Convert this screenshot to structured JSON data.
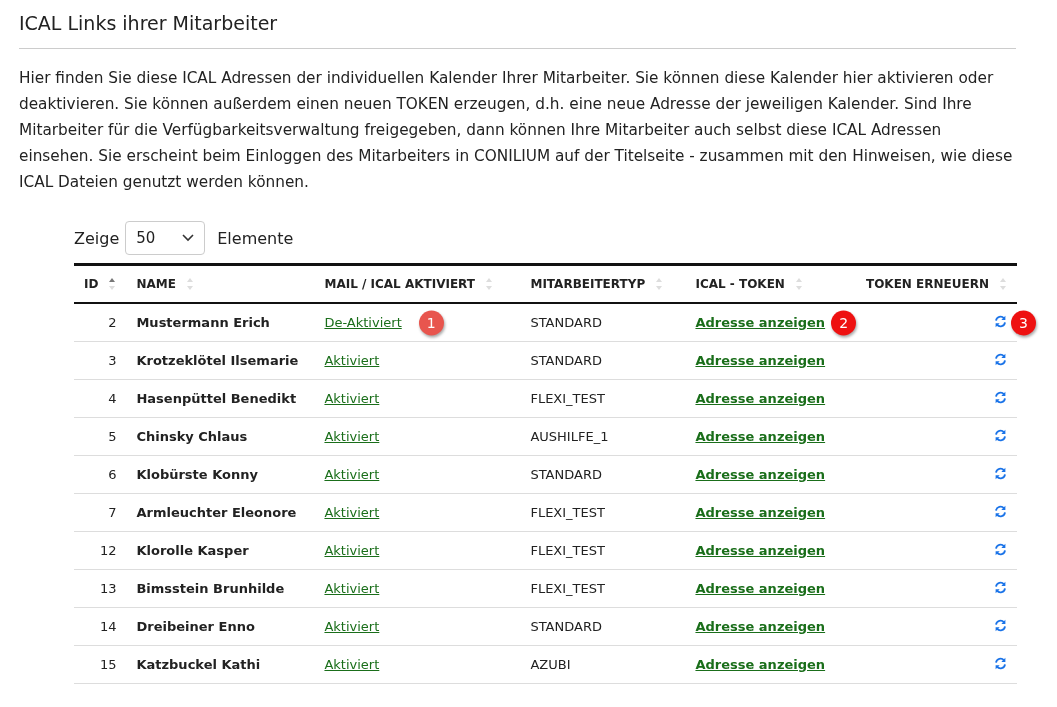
{
  "title": "ICAL Links ihrer Mitarbeiter",
  "intro": "Hier finden Sie diese ICAL Adressen der individuellen Kalender Ihrer Mitarbeiter. Sie können diese Kalender hier aktivieren oder deaktivieren. Sie können außerdem einen neuen TOKEN erzeugen, d.h. eine neue Adresse der jeweiligen Kalender. Sind Ihre Mitarbeiter für die Verfügbarkeitsverwaltung freigegeben, dann können Ihre Mitarbeiter auch selbst diese ICAL Adressen einsehen. Sie erscheint beim Einloggen des Mitarbeiters in CONILIUM auf der Titelseite - zusammen mit den Hinweisen, wie diese ICAL Dateien genutzt werden können.",
  "length": {
    "before": "Zeige",
    "value": "50",
    "after": "Elemente"
  },
  "table": {
    "columns": [
      {
        "label": "ID",
        "sorted": true
      },
      {
        "label": "NAME",
        "sorted": false
      },
      {
        "label": "MAIL / ICAL AKTIVIERT",
        "sorted": false
      },
      {
        "label": "MITARBEITERTYP",
        "sorted": false
      },
      {
        "label": "ICAL - TOKEN",
        "sorted": false
      },
      {
        "label": "TOKEN ERNEUERN",
        "sorted": false
      }
    ],
    "rows": [
      {
        "id": "2",
        "name": "Mustermann Erich",
        "mail": "De-Aktiviert",
        "mail_badge": {
          "text": "1",
          "color": "#e8554e"
        },
        "type": "STANDARD",
        "token": "Adresse anzeigen",
        "token_badge": {
          "text": "2",
          "color": "#ee1111"
        },
        "renew_badge": {
          "text": "3",
          "color": "#ee1111"
        }
      },
      {
        "id": "3",
        "name": "Krotzeklötel Ilsemarie",
        "mail": "Aktiviert",
        "type": "STANDARD",
        "token": "Adresse anzeigen"
      },
      {
        "id": "4",
        "name": "Hasenpüttel Benedikt",
        "mail": "Aktiviert",
        "type": "FLEXI_TEST",
        "token": "Adresse anzeigen"
      },
      {
        "id": "5",
        "name": "Chinsky Chlaus",
        "mail": "Aktiviert",
        "type": "AUSHILFE_1",
        "token": "Adresse anzeigen"
      },
      {
        "id": "6",
        "name": "Klobürste Konny",
        "mail": "Aktiviert",
        "type": "STANDARD",
        "token": "Adresse anzeigen"
      },
      {
        "id": "7",
        "name": "Armleuchter Eleonore",
        "mail": "Aktiviert",
        "type": "FLEXI_TEST",
        "token": "Adresse anzeigen"
      },
      {
        "id": "12",
        "name": "Klorolle Kasper",
        "mail": "Aktiviert",
        "type": "FLEXI_TEST",
        "token": "Adresse anzeigen"
      },
      {
        "id": "13",
        "name": "Bimsstein Brunhilde",
        "mail": "Aktiviert",
        "type": "FLEXI_TEST",
        "token": "Adresse anzeigen"
      },
      {
        "id": "14",
        "name": "Dreibeiner Enno",
        "mail": "Aktiviert",
        "type": "STANDARD",
        "token": "Adresse anzeigen"
      },
      {
        "id": "15",
        "name": "Katzbuckel Kathi",
        "mail": "Aktiviert",
        "type": "AZUBI",
        "token": "Adresse anzeigen"
      }
    ]
  }
}
